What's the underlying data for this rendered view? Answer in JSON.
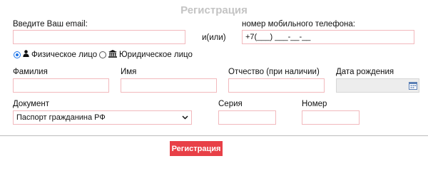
{
  "form": {
    "title": "Регистрация",
    "email_label": "Введите Ваш email:",
    "email_value": "",
    "or_text": "и(или)",
    "phone_label": "номер мобильного телефона:",
    "phone_value": "+7(___) ___-__-__",
    "person_types": [
      {
        "label": "Физическое лицо",
        "selected": true,
        "icon": "person-icon"
      },
      {
        "label": "Юридическое лицо",
        "selected": false,
        "icon": "institution-icon"
      }
    ],
    "lastname_label": "Фамилия",
    "firstname_label": "Имя",
    "patronymic_label": "Отчество (при наличии)",
    "birthdate_label": "Дата рождения",
    "document_label": "Документ",
    "document_selected": "Паспорт гражданина РФ",
    "series_label": "Серия",
    "number_label": "Номер",
    "submit_label": "Регистрация"
  },
  "colors": {
    "field_border": "#f2b9bd",
    "button_bg": "#e84047",
    "title": "#c4c4c4",
    "radio_accent": "#1a73e8"
  }
}
